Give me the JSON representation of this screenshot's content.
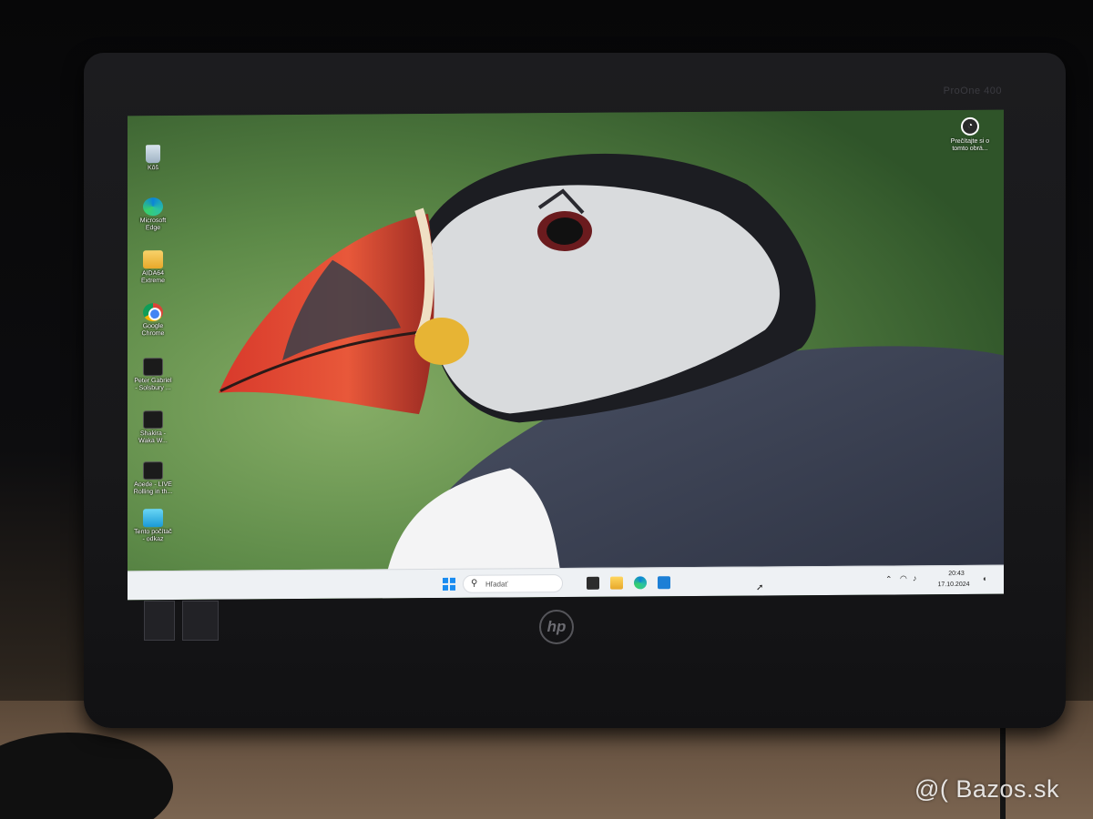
{
  "monitor": {
    "model": "ProOne 400",
    "brand_logo": "hp"
  },
  "desktop": {
    "icons": [
      {
        "name": "recycle-bin",
        "label": "Kôš",
        "icon": "recycle-bin-icon"
      },
      {
        "name": "microsoft-edge",
        "label": "Microsoft Edge",
        "icon": "edge-icon"
      },
      {
        "name": "aida64",
        "label": "AIDA64 Extreme",
        "icon": "folder-icon"
      },
      {
        "name": "google-chrome",
        "label": "Google Chrome",
        "icon": "chrome-icon"
      },
      {
        "name": "peter-gabriel",
        "label": "Peter Gabriel - Solsbury ...",
        "icon": "video-file-icon"
      },
      {
        "name": "shakira",
        "label": "Shakira - Waka W...",
        "icon": "video-file-icon"
      },
      {
        "name": "aoede",
        "label": "Aoede - LIVE Rolling in th...",
        "icon": "video-file-icon"
      },
      {
        "name": "this-pc",
        "label": "Tento počítač - odkaz",
        "icon": "pc-icon"
      }
    ],
    "spotlight": {
      "label": "Prečítajte si o tomto obrá...",
      "icon": "camera-lens-icon"
    }
  },
  "taskbar": {
    "search_label": "Hľadať",
    "time": "20:43",
    "date": "17.10.2024",
    "pinned": [
      "task-view-icon",
      "file-explorer-icon",
      "edge-icon",
      "store-icon"
    ],
    "tray": [
      "chevron-up-icon",
      "wifi-icon",
      "volume-icon",
      "notification-bell-icon"
    ]
  },
  "watermark": "@( Bazos.sk",
  "colors": {
    "taskbar_bg": "#eef1f4",
    "start_blue": "#1a8cf0",
    "wallpaper_green": "#5e8a4b"
  }
}
